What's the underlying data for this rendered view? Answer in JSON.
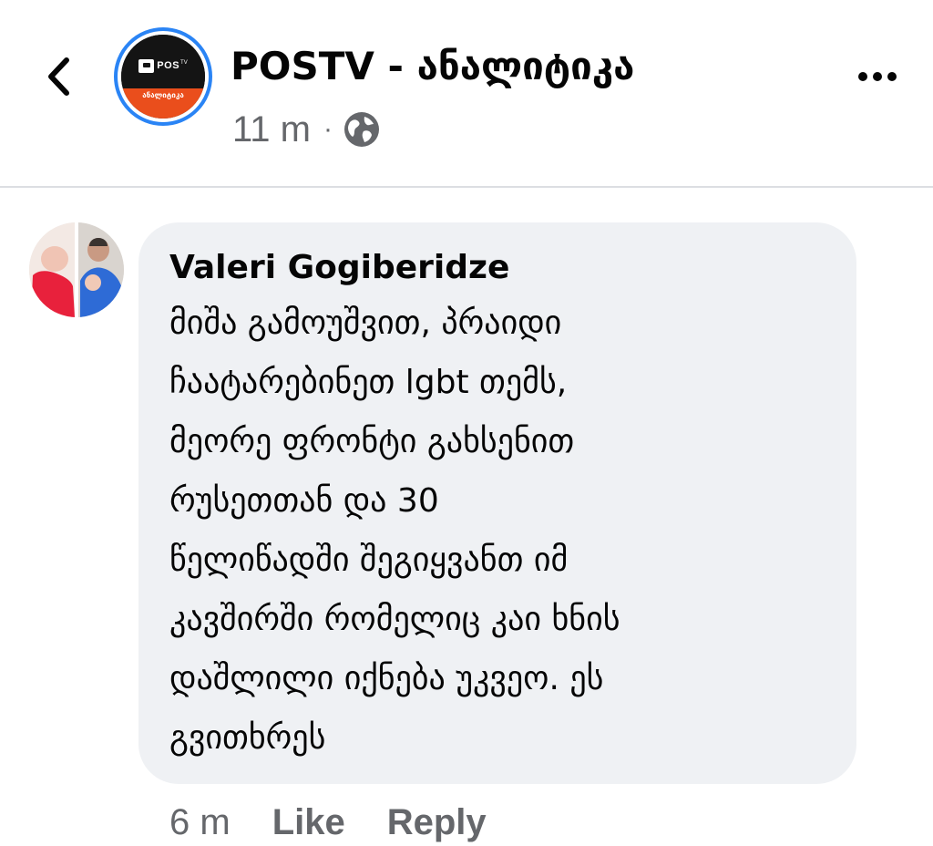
{
  "header": {
    "back_icon": "chevron-left-icon",
    "page_avatar": {
      "logo_text": "POS",
      "logo_superscript": "TV",
      "logo_sub": "ანალიტიკა",
      "ring_color": "#2a84f5",
      "accent_color": "#ea4e1c"
    },
    "page_name": "POSTV - ანალიტიკა",
    "post_time": "11 m",
    "separator": "·",
    "audience_icon": "globe-icon",
    "more_icon": "more-horizontal-icon"
  },
  "comment": {
    "author": "Valeri Gogiberidze",
    "lines": [
      "მიშა გამოუშვით, პრაიდი",
      "ჩაატარებინეთ lgbt თემს,",
      "მეორე ფრონტი გახსენით",
      "რუსეთთან და 30",
      "წელიწადში შეგიყვანთ იმ",
      "კავშირში რომელიც კაი ხნის",
      "დაშლილი იქნება უკვეო. ეს",
      "გვითხრეს"
    ],
    "bubble_color": "#eff1f4"
  },
  "actions": {
    "time": "6 m",
    "like_label": "Like",
    "reply_label": "Reply"
  }
}
